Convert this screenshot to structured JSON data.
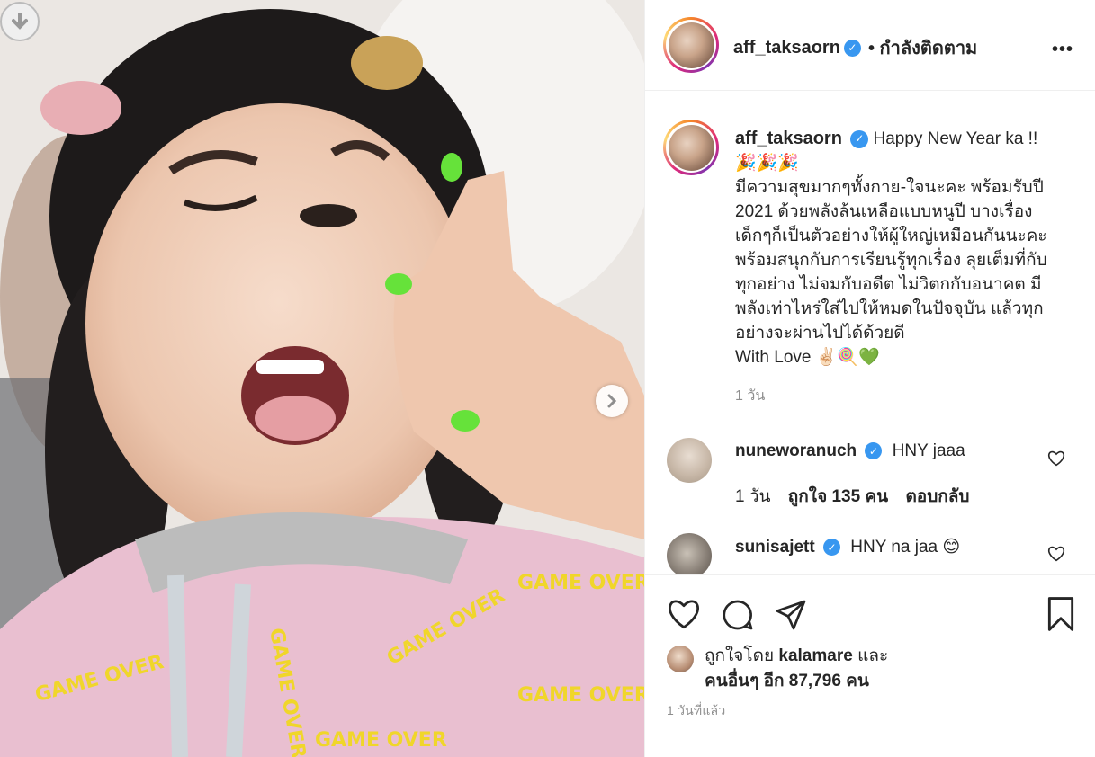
{
  "post": {
    "username": "aff_taksaorn",
    "follow_status": "• กำลังติดตาม",
    "more_label": "•••",
    "caption": {
      "lines": [
        "Happy New Year ka !!",
        "🎉🎉🎉",
        "มีความสุขมากๆทั้งกาย-ใจนะคะ พร้อมรับปี",
        "2021 ด้วยพลังล้นเหลือแบบหนูปี บางเรื่อง",
        "เด็กๆก็เป็นตัวอย่างให้ผู้ใหญ่เหมือนกันนะคะ",
        "พร้อมสนุกกับการเรียนรู้ทุกเรื่อง ลุยเต็มที่กับ",
        "ทุกอย่าง ไม่จมกับอดีต ไม่วิตกกับอนาคต มี",
        "พลังเท่าไหร่ใส่ไปให้หมดในปัจจุบัน แล้วทุก",
        "อย่างจะผ่านไปได้ด้วยดี",
        "With Love ✌🏻🍭💚"
      ],
      "time": "1 วัน"
    },
    "photo_text": "GAME OVER"
  },
  "comments": [
    {
      "username": "nuneworanuch",
      "text": "HNY jaaa",
      "time": "1 วัน",
      "likes": "ถูกใจ 135 คน",
      "reply": "ตอบกลับ"
    },
    {
      "username": "sunisajett",
      "text": "HNY na jaa 😊"
    }
  ],
  "likes": {
    "prefix": "ถูกใจโดย",
    "user": "kalamare",
    "joiner": "และ",
    "others": "คนอื่นๆ อีก 87,796 คน"
  },
  "posted": "1 วันที่แล้ว",
  "icons": {
    "download": "arrow-down-icon",
    "next": "chevron-right-icon",
    "like": "heart-icon",
    "comment": "speech-bubble-icon",
    "share": "paper-plane-icon",
    "save": "bookmark-icon",
    "verified": "verified-badge-icon"
  },
  "colors": {
    "verified": "#3897f0",
    "text": "#262626",
    "muted": "#8e8e8e"
  }
}
